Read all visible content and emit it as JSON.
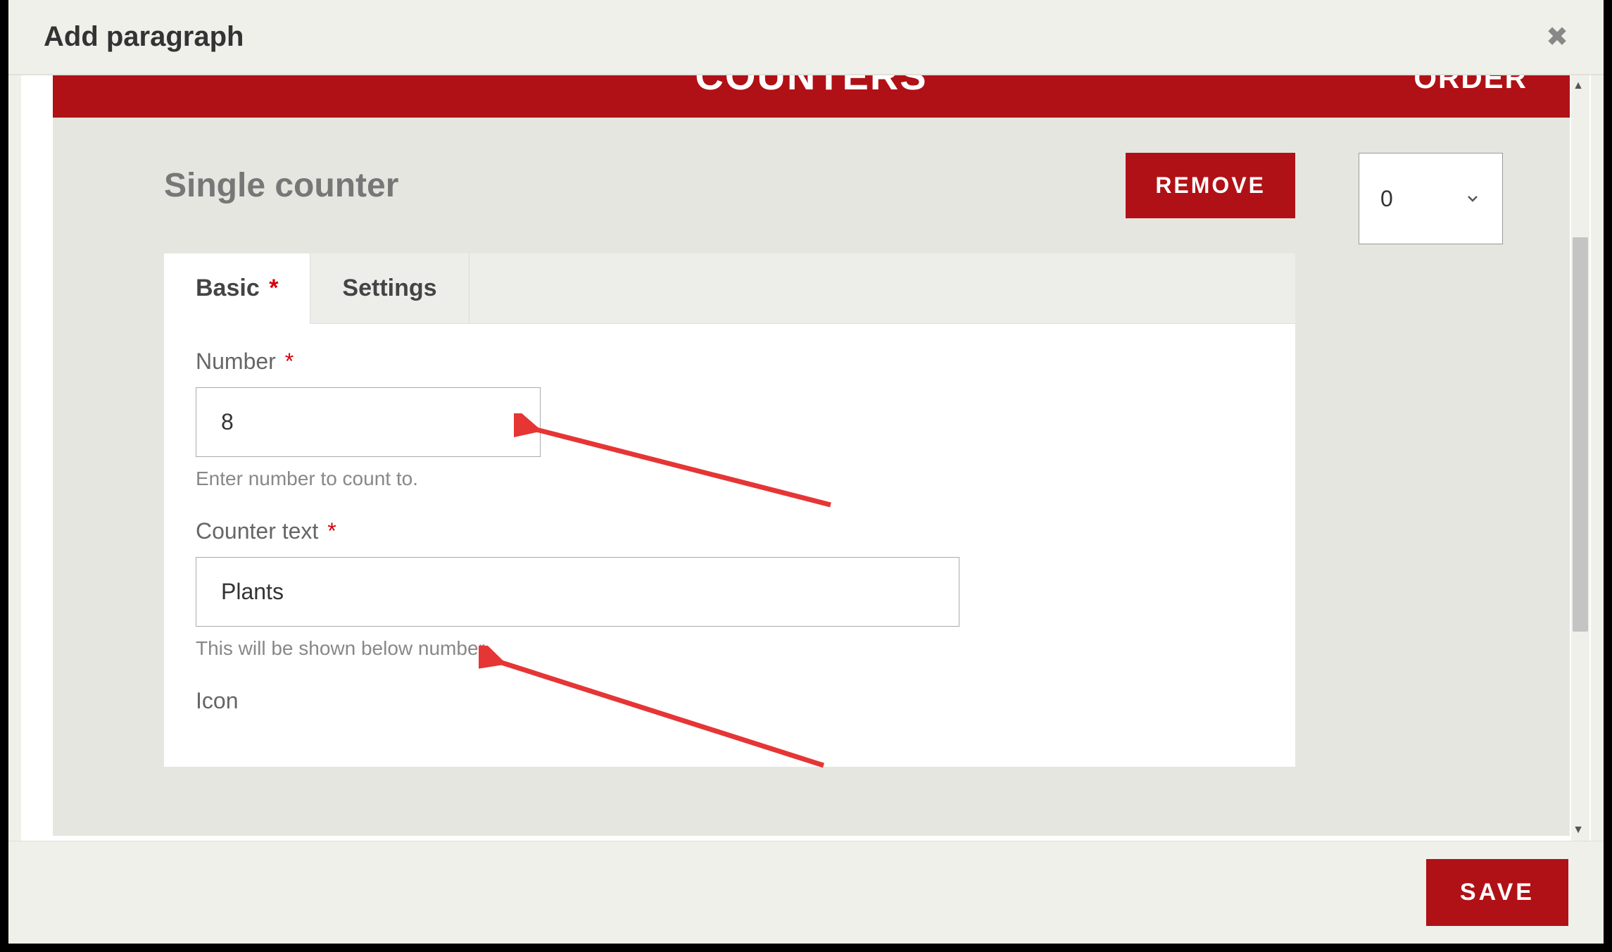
{
  "modal": {
    "title": "Add paragraph"
  },
  "banner": {
    "title": "COUNTERS",
    "order_label": "ORDER"
  },
  "panel": {
    "title": "Single counter",
    "remove_label": "REMOVE"
  },
  "tabs": {
    "basic": "Basic",
    "settings": "Settings"
  },
  "fields": {
    "number": {
      "label": "Number",
      "value": "8",
      "help": "Enter number to count to."
    },
    "counter_text": {
      "label": "Counter text",
      "value": "Plants",
      "help": "This will be shown below number."
    },
    "icon": {
      "label": "Icon"
    }
  },
  "order": {
    "value": "0"
  },
  "footer": {
    "save_label": "SAVE"
  },
  "required_marker": "*"
}
